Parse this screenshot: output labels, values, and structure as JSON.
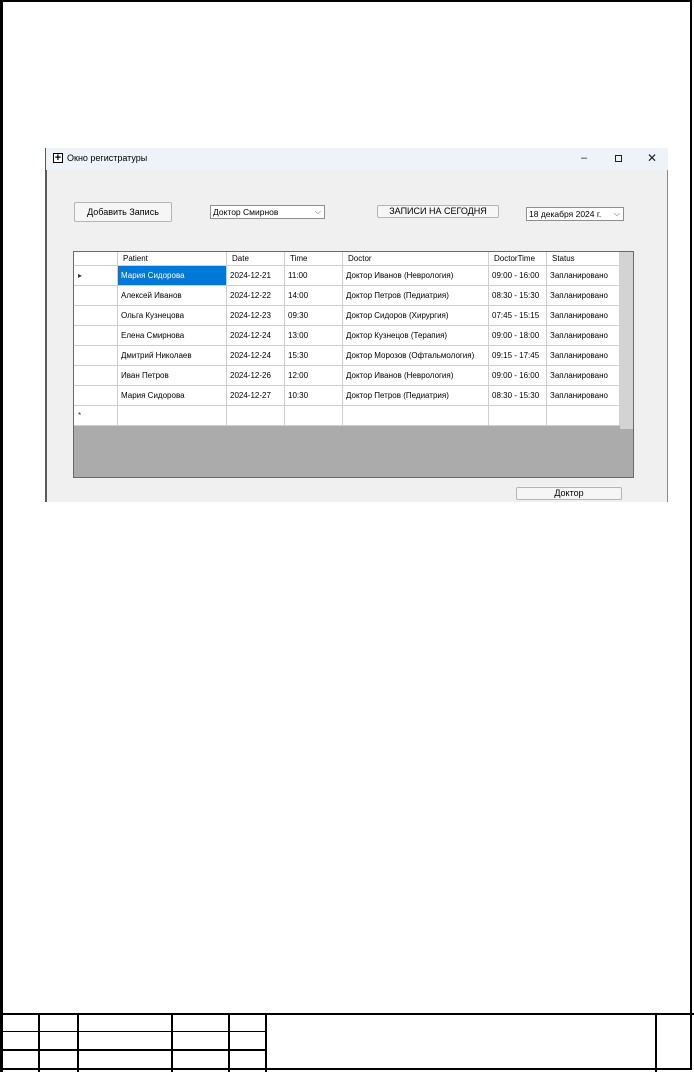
{
  "window": {
    "title": "Окно регистратуры",
    "controls": {
      "minimize": "–",
      "close": "✕"
    }
  },
  "toolbar": {
    "add_label": "Добавить Запись",
    "doctor_select": "Доктор Смирнов",
    "today_label": "ЗАПИСИ НА СЕГОДНЯ",
    "date_value": "18  декабря  2024 г."
  },
  "grid": {
    "columns": [
      "Patient",
      "Date",
      "Time",
      "Doctor",
      "DoctorTime",
      "Status"
    ],
    "current_row_marker": "▸",
    "new_row_marker": "*",
    "rows": [
      [
        "Мария Сидорова",
        "2024-12-21",
        "11:00",
        "Доктор Иванов (Неврология)",
        "09:00 - 16:00",
        "Запланировано"
      ],
      [
        "Алексей Иванов",
        "2024-12-22",
        "14:00",
        "Доктор Петров (Педиатрия)",
        "08:30 - 15:30",
        "Запланировано"
      ],
      [
        "Ольга Кузнецова",
        "2024-12-23",
        "09:30",
        "Доктор Сидоров (Хирургия)",
        "07:45 - 15:15",
        "Запланировано"
      ],
      [
        "Елена Смирнова",
        "2024-12-24",
        "13:00",
        "Доктор Кузнецов (Терапия)",
        "09:00 - 18:00",
        "Запланировано"
      ],
      [
        "Дмитрий Николаев",
        "2024-12-24",
        "15:30",
        "Доктор Морозов (Офтальмология)",
        "09:15 - 17:45",
        "Запланировано"
      ],
      [
        "Иван Петров",
        "2024-12-26",
        "12:00",
        "Доктор Иванов (Неврология)",
        "09:00 - 16:00",
        "Запланировано"
      ],
      [
        "Мария Сидорова",
        "2024-12-27",
        "10:30",
        "Доктор Петров (Педиатрия)",
        "08:30 - 15:30",
        "Запланировано"
      ]
    ]
  },
  "footer": {
    "doctor_button": "Доктор"
  },
  "colors": {
    "selection": "#0078d7",
    "window_bg": "#f0f0f0",
    "grid_bg": "#ababab"
  }
}
